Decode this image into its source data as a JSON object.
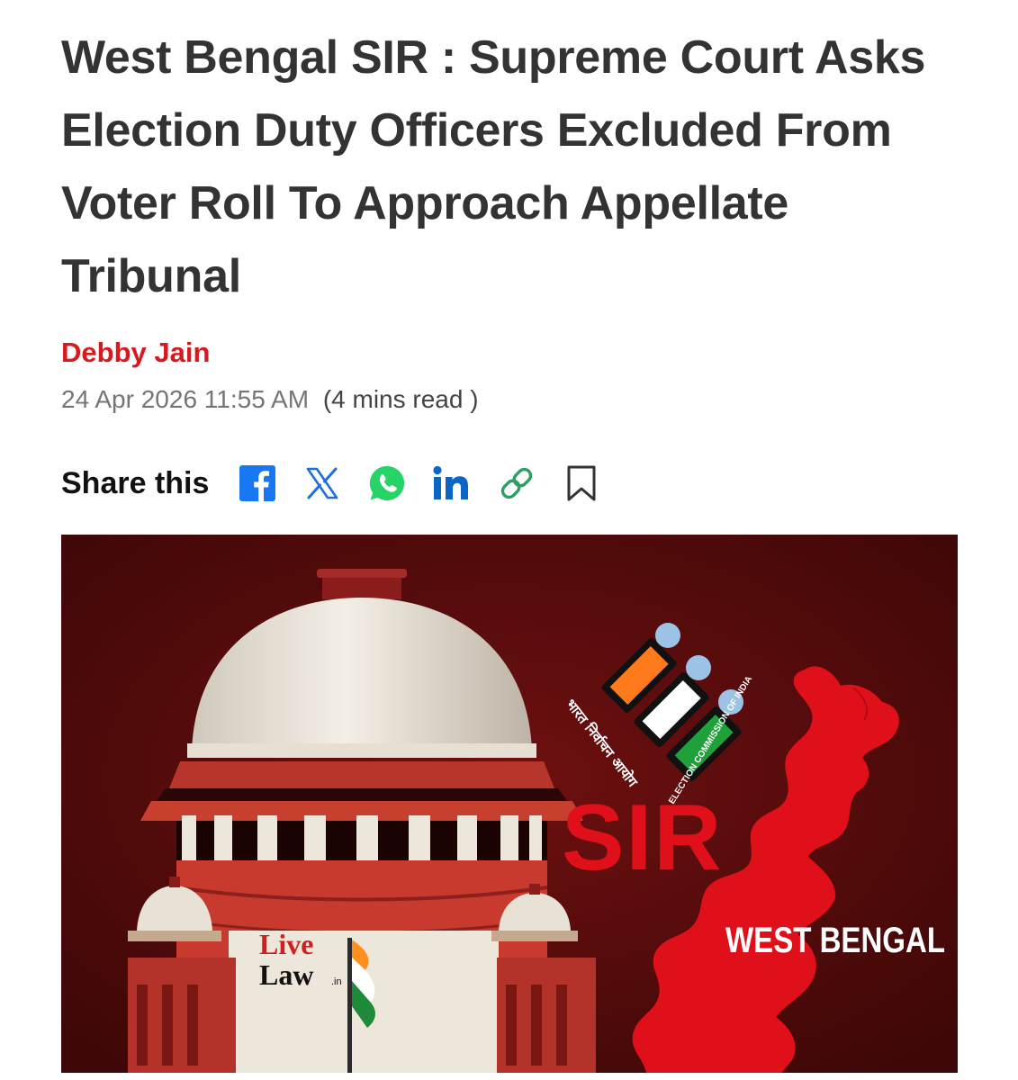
{
  "article": {
    "headline": "West Bengal SIR : Supreme Court Asks Election Duty Officers Excluded From Voter Roll To Approach Appellate Tribunal",
    "author": "Debby Jain",
    "date": "24 Apr 2026 11:55 AM",
    "read_time": "(4 mins read )"
  },
  "share": {
    "label": "Share this",
    "buttons": [
      {
        "name": "facebook-icon",
        "color": "#1877f2"
      },
      {
        "name": "x-icon",
        "color": "#1d6fe0"
      },
      {
        "name": "whatsapp-icon",
        "color": "#25d366"
      },
      {
        "name": "linkedin-icon",
        "color": "#0a66c2"
      },
      {
        "name": "link-icon",
        "color": "#2e9e62"
      },
      {
        "name": "bookmark-icon",
        "color": "#333333"
      }
    ]
  },
  "hero_image": {
    "sir_text": "SIR",
    "state_text": "WEST BENGAL",
    "logo_line1": "Live",
    "logo_line2": "Law",
    "logo_suffix": ".in",
    "eci_text_en": "ELECTION COMMISSION OF INDIA",
    "eci_text_hi": "भारत निर्वाचन आयोग"
  },
  "colors": {
    "author": "#d71920",
    "headline": "#333333",
    "hero_bg": "#5a0c0c",
    "map_red": "#e0101a"
  }
}
